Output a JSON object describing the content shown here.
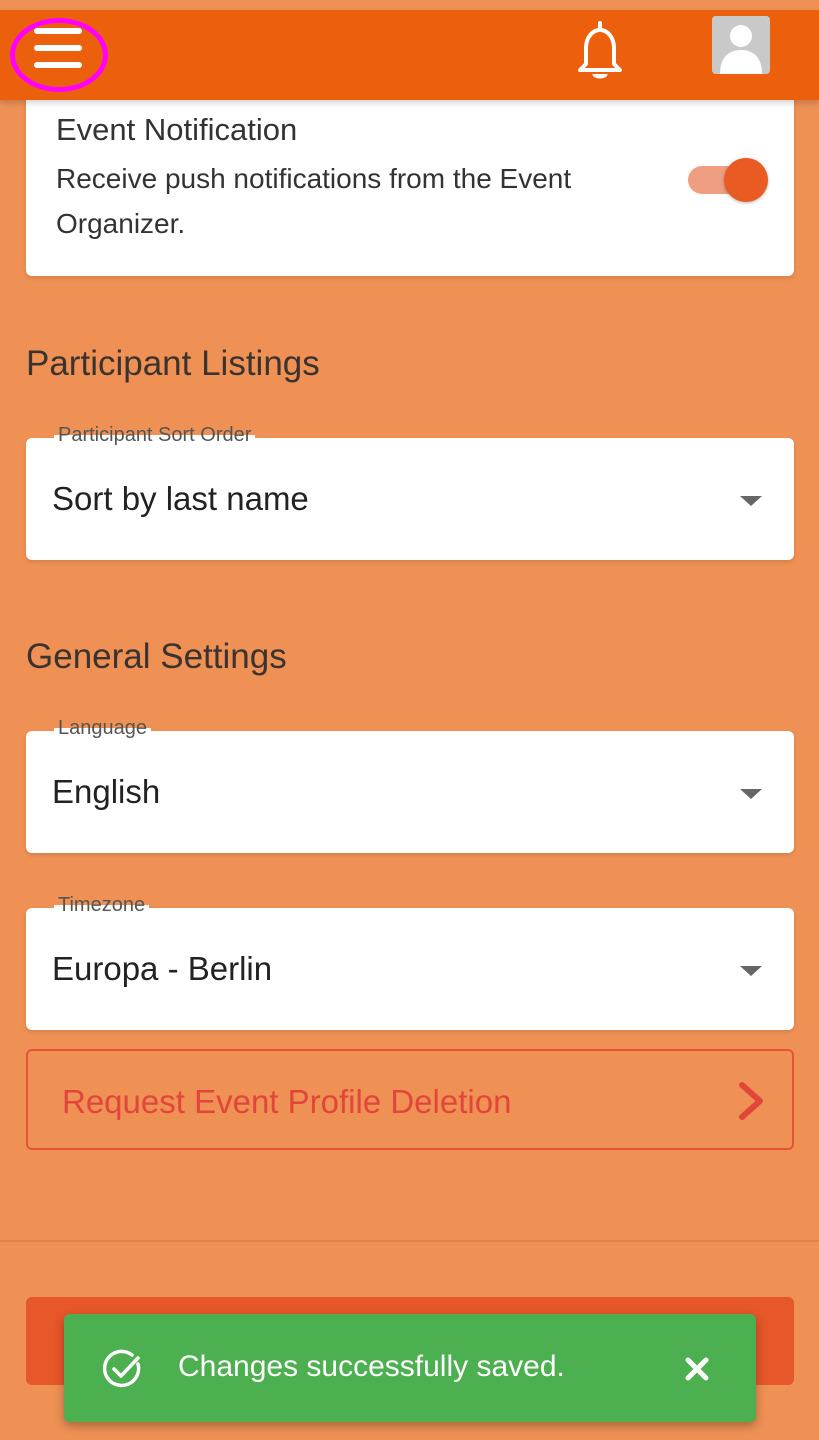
{
  "header": {
    "menu_icon": "hamburger-menu-icon",
    "bell_icon": "bell-icon",
    "avatar_icon": "user-avatar-icon",
    "bar_color": "#ec5f0c",
    "highlight_color": "#ff00ff"
  },
  "event_notification": {
    "title": "Event Notification",
    "description": "Receive push notifications from the Event Organizer.",
    "toggle_on": true
  },
  "participant_listings": {
    "heading": "Participant Listings",
    "sort_order": {
      "label": "Participant Sort Order",
      "value": "Sort by last name"
    }
  },
  "general_settings": {
    "heading": "General Settings",
    "language": {
      "label": "Language",
      "value": "English"
    },
    "timezone": {
      "label": "Timezone",
      "value": "Europa - Berlin"
    }
  },
  "delete_profile": {
    "label": "Request Event Profile Deletion",
    "color": "#e2463a"
  },
  "toast": {
    "message": "Changes successfully saved.",
    "color": "#4caf50",
    "check_icon": "check-circle-icon",
    "close_icon": "close-icon"
  },
  "colors": {
    "background": "#ef9155",
    "accent": "#e95b22"
  }
}
